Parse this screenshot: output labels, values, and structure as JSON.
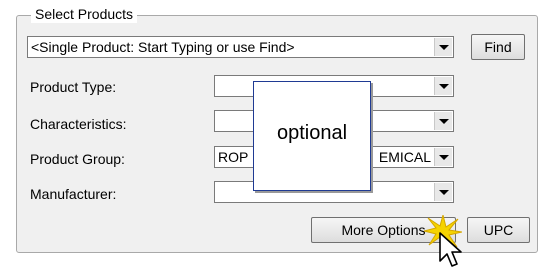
{
  "groupbox": {
    "title": "Select Products"
  },
  "single_product": {
    "value": "<Single Product: Start Typing or use Find>"
  },
  "buttons": {
    "find": "Find",
    "more_options": "More Options",
    "upc": "UPC"
  },
  "fields": {
    "product_type": {
      "label": "Product Type:",
      "value": ""
    },
    "characteristics": {
      "label": "Characteristics:",
      "value": ""
    },
    "product_group": {
      "label": "Product Group:",
      "value_left": "ROP",
      "value_right": "EMICAL"
    },
    "manufacturer": {
      "label": "Manufacturer:",
      "value": ""
    }
  },
  "tooltip": {
    "text": "optional"
  },
  "icons": {
    "dropdown": "chevron-down-icon",
    "cursor": "mouse-pointer-icon",
    "highlight": "click-burst-icon"
  },
  "colors": {
    "tooltip_border": "#1f3a93",
    "burst": "#f5d300"
  }
}
